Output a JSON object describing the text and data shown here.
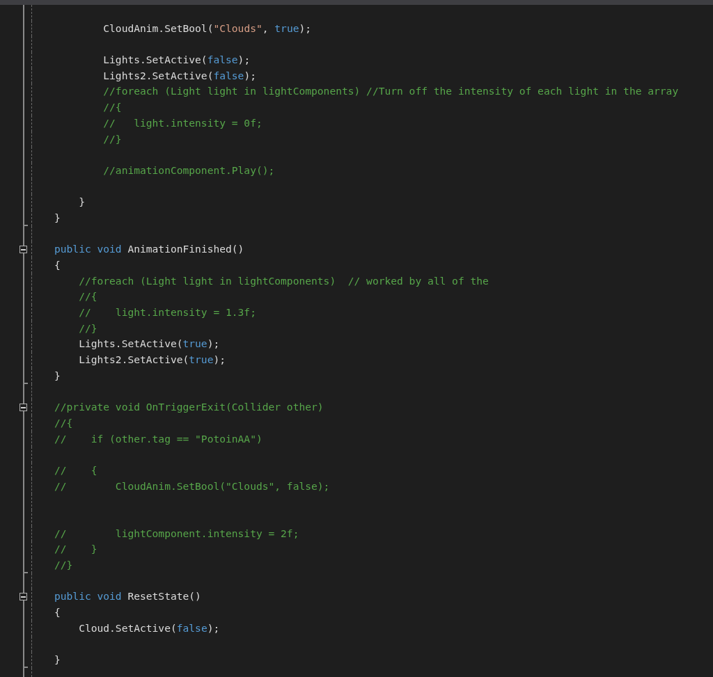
{
  "editor": {
    "lines": [
      {
        "kind": "blank"
      },
      {
        "kind": "code",
        "tokens": [
          {
            "kind": "plain",
            "text": "        CloudAnim.SetBool("
          },
          {
            "kind": "string",
            "text": "\"Clouds\""
          },
          {
            "kind": "plain",
            "text": ", "
          },
          {
            "kind": "keyword",
            "text": "true"
          },
          {
            "kind": "plain",
            "text": ");"
          }
        ]
      },
      {
        "kind": "blank"
      },
      {
        "kind": "code",
        "tokens": [
          {
            "kind": "plain",
            "text": "        Lights.SetActive("
          },
          {
            "kind": "keyword",
            "text": "false"
          },
          {
            "kind": "plain",
            "text": ");"
          }
        ]
      },
      {
        "kind": "code",
        "tokens": [
          {
            "kind": "plain",
            "text": "        Lights2.SetActive("
          },
          {
            "kind": "keyword",
            "text": "false"
          },
          {
            "kind": "plain",
            "text": ");"
          }
        ]
      },
      {
        "kind": "code",
        "tokens": [
          {
            "kind": "comment",
            "text": "        //foreach (Light light in lightComponents) //Turn off the intensity of each light in the array"
          }
        ]
      },
      {
        "kind": "code",
        "tokens": [
          {
            "kind": "comment",
            "text": "        //{"
          }
        ]
      },
      {
        "kind": "code",
        "tokens": [
          {
            "kind": "comment",
            "text": "        //   light.intensity = 0f;"
          }
        ]
      },
      {
        "kind": "code",
        "tokens": [
          {
            "kind": "comment",
            "text": "        //}"
          }
        ]
      },
      {
        "kind": "blank"
      },
      {
        "kind": "code",
        "tokens": [
          {
            "kind": "comment",
            "text": "        //animationComponent.Play();"
          }
        ]
      },
      {
        "kind": "blank"
      },
      {
        "kind": "code",
        "tokens": [
          {
            "kind": "plain",
            "text": "    }"
          }
        ]
      },
      {
        "kind": "code",
        "block_end": true,
        "tokens": [
          {
            "kind": "plain",
            "text": "}"
          }
        ]
      },
      {
        "kind": "blank"
      },
      {
        "kind": "code",
        "expanded": true,
        "tokens": [
          {
            "kind": "keyword",
            "text": "public void"
          },
          {
            "kind": "plain",
            "text": " AnimationFinished()"
          }
        ]
      },
      {
        "kind": "code",
        "tokens": [
          {
            "kind": "plain",
            "text": "{"
          }
        ]
      },
      {
        "kind": "code",
        "tokens": [
          {
            "kind": "comment",
            "text": "    //foreach (Light light in lightComponents)  // worked by all of the"
          }
        ]
      },
      {
        "kind": "code",
        "tokens": [
          {
            "kind": "comment",
            "text": "    //{"
          }
        ]
      },
      {
        "kind": "code",
        "tokens": [
          {
            "kind": "comment",
            "text": "    //    light.intensity = 1.3f;"
          }
        ]
      },
      {
        "kind": "code",
        "tokens": [
          {
            "kind": "comment",
            "text": "    //}"
          }
        ]
      },
      {
        "kind": "code",
        "tokens": [
          {
            "kind": "plain",
            "text": "    Lights.SetActive("
          },
          {
            "kind": "keyword",
            "text": "true"
          },
          {
            "kind": "plain",
            "text": ");"
          }
        ]
      },
      {
        "kind": "code",
        "tokens": [
          {
            "kind": "plain",
            "text": "    Lights2.SetActive("
          },
          {
            "kind": "keyword",
            "text": "true"
          },
          {
            "kind": "plain",
            "text": ");"
          }
        ]
      },
      {
        "kind": "code",
        "block_end": true,
        "tokens": [
          {
            "kind": "plain",
            "text": "}"
          }
        ]
      },
      {
        "kind": "blank"
      },
      {
        "kind": "code",
        "expanded": true,
        "tokens": [
          {
            "kind": "comment",
            "text": "//private void OnTriggerExit(Collider other)"
          }
        ]
      },
      {
        "kind": "code",
        "tokens": [
          {
            "kind": "comment",
            "text": "//{"
          }
        ]
      },
      {
        "kind": "code",
        "tokens": [
          {
            "kind": "comment",
            "text": "//    if (other.tag == \"PotoinAA\")"
          }
        ]
      },
      {
        "kind": "blank"
      },
      {
        "kind": "code",
        "tokens": [
          {
            "kind": "comment",
            "text": "//    {"
          }
        ]
      },
      {
        "kind": "code",
        "tokens": [
          {
            "kind": "comment",
            "text": "//        CloudAnim.SetBool(\"Clouds\", false);"
          }
        ]
      },
      {
        "kind": "blank"
      },
      {
        "kind": "blank"
      },
      {
        "kind": "code",
        "tokens": [
          {
            "kind": "comment",
            "text": "//        lightComponent.intensity = 2f;"
          }
        ]
      },
      {
        "kind": "code",
        "tokens": [
          {
            "kind": "comment",
            "text": "//    }"
          }
        ]
      },
      {
        "kind": "code",
        "block_end": true,
        "tokens": [
          {
            "kind": "comment",
            "text": "//}"
          }
        ]
      },
      {
        "kind": "blank"
      },
      {
        "kind": "code",
        "expanded": true,
        "tokens": [
          {
            "kind": "keyword",
            "text": "public void"
          },
          {
            "kind": "plain",
            "text": " ResetState()"
          }
        ]
      },
      {
        "kind": "code",
        "tokens": [
          {
            "kind": "plain",
            "text": "{"
          }
        ]
      },
      {
        "kind": "code",
        "tokens": [
          {
            "kind": "plain",
            "text": "    Cloud.SetActive("
          },
          {
            "kind": "keyword",
            "text": "false"
          },
          {
            "kind": "plain",
            "text": ");"
          }
        ]
      },
      {
        "kind": "blank"
      },
      {
        "kind": "code",
        "block_end": true,
        "tokens": [
          {
            "kind": "plain",
            "text": "}"
          }
        ]
      },
      {
        "kind": "blank"
      }
    ]
  }
}
